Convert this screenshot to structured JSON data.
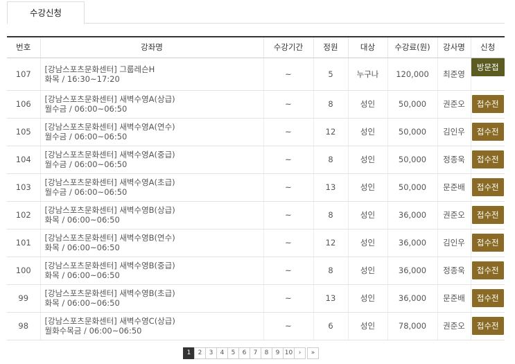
{
  "tabs": [
    {
      "label": "수강신청"
    }
  ],
  "table": {
    "headers": [
      "번호",
      "강좌명",
      "수강기간",
      "정원",
      "대상",
      "수강료(원)",
      "강사명",
      "신청"
    ],
    "rows": [
      {
        "no": "107",
        "name": "[강남스포츠문화센터] 그룹레슨H",
        "schedule": "화목 / 16:30~17:20",
        "period": "~",
        "capacity": "5",
        "target": "누구나",
        "fee": "120,000",
        "instructor": "최준영",
        "action": "방문접수",
        "action_type": "visit"
      },
      {
        "no": "106",
        "name": "[강남스포츠문화센터] 새벽수영A(상급)",
        "schedule": "월수금 / 06:00~06:50",
        "period": "~",
        "capacity": "8",
        "target": "성인",
        "fee": "50,000",
        "instructor": "권준오",
        "action": "접수전",
        "action_type": "before"
      },
      {
        "no": "105",
        "name": "[강남스포츠문화센터] 새벽수영A(연수)",
        "schedule": "월수금 / 06:00~06:50",
        "period": "~",
        "capacity": "12",
        "target": "성인",
        "fee": "50,000",
        "instructor": "김인우",
        "action": "접수전",
        "action_type": "before"
      },
      {
        "no": "104",
        "name": "[강남스포츠문화센터] 새벽수영A(중급)",
        "schedule": "월수금 / 06:00~06:50",
        "period": "~",
        "capacity": "8",
        "target": "성인",
        "fee": "50,000",
        "instructor": "정종욱",
        "action": "접수전",
        "action_type": "before"
      },
      {
        "no": "103",
        "name": "[강남스포츠문화센터] 새벽수영A(초급)",
        "schedule": "월수금 / 06:00~06:50",
        "period": "~",
        "capacity": "13",
        "target": "성인",
        "fee": "50,000",
        "instructor": "문준배",
        "action": "접수전",
        "action_type": "before"
      },
      {
        "no": "102",
        "name": "[강남스포츠문화센터] 새벽수영B(상급)",
        "schedule": "화목 / 06:00~06:50",
        "period": "~",
        "capacity": "8",
        "target": "성인",
        "fee": "36,000",
        "instructor": "권준오",
        "action": "접수전",
        "action_type": "before"
      },
      {
        "no": "101",
        "name": "[강남스포츠문화센터] 새벽수영B(연수)",
        "schedule": "화목 / 06:00~06:50",
        "period": "~",
        "capacity": "12",
        "target": "성인",
        "fee": "36,000",
        "instructor": "김인우",
        "action": "접수전",
        "action_type": "before"
      },
      {
        "no": "100",
        "name": "[강남스포츠문화센터] 새벽수영B(중급)",
        "schedule": "화목 / 06:00~06:50",
        "period": "~",
        "capacity": "8",
        "target": "성인",
        "fee": "36,000",
        "instructor": "정종욱",
        "action": "접수전",
        "action_type": "before"
      },
      {
        "no": "99",
        "name": "[강남스포츠문화센터] 새벽수영B(초급)",
        "schedule": "화목 / 06:00~06:50",
        "period": "~",
        "capacity": "13",
        "target": "성인",
        "fee": "36,000",
        "instructor": "문준배",
        "action": "접수전",
        "action_type": "before"
      },
      {
        "no": "98",
        "name": "[강남스포츠문화센터] 새벽수영C(상급)",
        "schedule": "월화수목금 / 06:00~06:50",
        "period": "~",
        "capacity": "6",
        "target": "성인",
        "fee": "78,000",
        "instructor": "권준오",
        "action": "접수전",
        "action_type": "before"
      }
    ]
  },
  "pagination": {
    "pages": [
      "1",
      "2",
      "3",
      "4",
      "5",
      "6",
      "7",
      "8",
      "9",
      "10"
    ],
    "current": "1",
    "next": "›",
    "last": "»"
  },
  "colors": {
    "visit_button": "#5c5c22",
    "before_button": "#8a6a24",
    "active_page": "#333333"
  }
}
